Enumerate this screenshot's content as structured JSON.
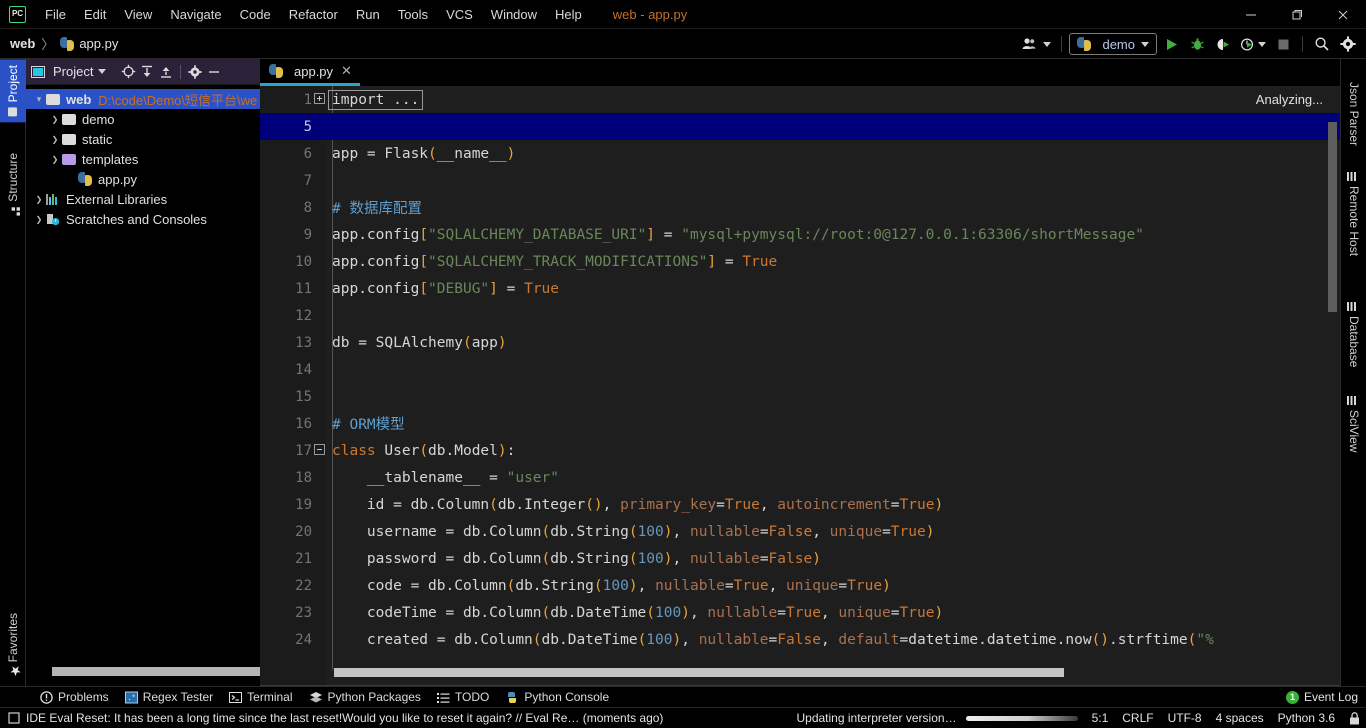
{
  "window": {
    "app_icon": "pycharm-logo-icon",
    "title": "web - app.py",
    "controls": {
      "minimize": "minimize-icon",
      "maximize": "maximize-icon",
      "close": "close-icon"
    }
  },
  "menu": {
    "items": [
      {
        "label": "File",
        "mnemonic": "F"
      },
      {
        "label": "Edit",
        "mnemonic": "E"
      },
      {
        "label": "View",
        "mnemonic": "V"
      },
      {
        "label": "Navigate",
        "mnemonic": "N"
      },
      {
        "label": "Code",
        "mnemonic": "C"
      },
      {
        "label": "Refactor",
        "mnemonic": "R"
      },
      {
        "label": "Run",
        "mnemonic": "u"
      },
      {
        "label": "Tools",
        "mnemonic": "T"
      },
      {
        "label": "VCS",
        "mnemonic": "V"
      },
      {
        "label": "Window",
        "mnemonic": "W"
      },
      {
        "label": "Help",
        "mnemonic": "H"
      }
    ]
  },
  "navbar": {
    "breadcrumbs": [
      {
        "label": "web",
        "icon": ""
      },
      {
        "label": "app.py",
        "icon": "python-file-icon"
      }
    ],
    "separator": "〉",
    "right": {
      "user_icon": "user-accounts-icon",
      "run_config": {
        "icon": "python-file-icon",
        "label": "demo",
        "caret": "chevron-down-icon"
      },
      "run_icon": "run-play-icon",
      "debug_icon": "debug-bug-icon",
      "coverage_icon": "run-with-coverage-icon",
      "profile_icon": "profile-icon",
      "stop_icon": "stop-icon",
      "search_icon": "search-icon",
      "settings_icon": "gear-icon"
    }
  },
  "left_strip": {
    "tabs": [
      {
        "label": "Project",
        "icon": "project-folder-icon",
        "selected": true
      },
      {
        "label": "Structure",
        "icon": "structure-icon",
        "selected": false
      }
    ],
    "bottom_tabs": [
      {
        "label": "Favorites",
        "icon": "star-icon",
        "selected": false
      }
    ]
  },
  "project_panel": {
    "title": "Project",
    "title_icon": "project-view-icon",
    "title_caret": "chevron-down-icon",
    "toolbar": [
      {
        "name": "select-opened-file-icon",
        "glyph": "⊕"
      },
      {
        "name": "expand-all-icon",
        "glyph": "↧"
      },
      {
        "name": "collapse-all-icon",
        "glyph": "↥"
      },
      {
        "name": "gear-icon",
        "glyph": "⚙"
      },
      {
        "name": "hide-icon",
        "glyph": "—"
      }
    ],
    "tree": [
      {
        "label": "web",
        "path": "D:\\code\\Demo\\短信平台\\we",
        "icon": "folder-icon",
        "indent": 0,
        "arrow": "expanded",
        "selected": true,
        "bold": true
      },
      {
        "label": "demo",
        "icon": "folder-icon",
        "indent": 1,
        "arrow": "collapsed",
        "selected": false,
        "bold": false
      },
      {
        "label": "static",
        "icon": "folder-icon",
        "indent": 1,
        "arrow": "collapsed",
        "selected": false,
        "bold": false
      },
      {
        "label": "templates",
        "icon": "folder-purple-icon",
        "indent": 1,
        "arrow": "collapsed",
        "selected": false,
        "bold": false
      },
      {
        "label": "app.py",
        "icon": "python-file-icon",
        "indent": 2,
        "arrow": "none",
        "selected": false,
        "bold": false
      },
      {
        "label": "External Libraries",
        "icon": "libraries-icon",
        "indent": 0,
        "arrow": "collapsed",
        "selected": false,
        "bold": false
      },
      {
        "label": "Scratches and Consoles",
        "icon": "scratches-icon",
        "indent": 0,
        "arrow": "collapsed",
        "selected": false,
        "bold": false
      }
    ]
  },
  "editor": {
    "tabs": [
      {
        "label": "app.py",
        "icon": "python-file-icon",
        "close": "✕",
        "active": true
      }
    ],
    "inspection_status": "Analyzing...",
    "caret_line": 5,
    "lines": [
      {
        "num": "1",
        "fold": "+",
        "boxed": true,
        "tokens": [
          {
            "t": "import ...",
            "c": "dim"
          }
        ]
      },
      {
        "num": "5",
        "fold": "",
        "highlight": true,
        "tokens": []
      },
      {
        "num": "6",
        "fold": "",
        "tokens": [
          {
            "t": "app ",
            "c": "dim"
          },
          {
            "t": "= ",
            "c": "dim"
          },
          {
            "t": "Flask",
            "c": "dim"
          },
          {
            "t": "(",
            "c": "par"
          },
          {
            "t": "__name__",
            "c": "dim"
          },
          {
            "t": ")",
            "c": "par"
          }
        ]
      },
      {
        "num": "7",
        "fold": "",
        "tokens": []
      },
      {
        "num": "8",
        "fold": "",
        "tokens": [
          {
            "t": "# ",
            "c": "cmt-ch"
          },
          {
            "t": "数据库配置",
            "c": "cmt-ch"
          }
        ]
      },
      {
        "num": "9",
        "fold": "",
        "tokens": [
          {
            "t": "app.config",
            "c": "dim"
          },
          {
            "t": "[",
            "c": "par"
          },
          {
            "t": "\"SQLALCHEMY_DATABASE_URI\"",
            "c": "str"
          },
          {
            "t": "]",
            "c": "par"
          },
          {
            "t": " = ",
            "c": "dim"
          },
          {
            "t": "\"mysql+pymysql://root:0@127.0.0.1:63306/shortMessage\"",
            "c": "str"
          }
        ]
      },
      {
        "num": "10",
        "fold": "",
        "tokens": [
          {
            "t": "app.config",
            "c": "dim"
          },
          {
            "t": "[",
            "c": "par"
          },
          {
            "t": "\"SQLALCHEMY_TRACK_MODIFICATIONS\"",
            "c": "str"
          },
          {
            "t": "]",
            "c": "par"
          },
          {
            "t": " = ",
            "c": "dim"
          },
          {
            "t": "True",
            "c": "kw"
          }
        ]
      },
      {
        "num": "11",
        "fold": "",
        "tokens": [
          {
            "t": "app.config",
            "c": "dim"
          },
          {
            "t": "[",
            "c": "par"
          },
          {
            "t": "\"DEBUG\"",
            "c": "str"
          },
          {
            "t": "]",
            "c": "par"
          },
          {
            "t": " = ",
            "c": "dim"
          },
          {
            "t": "True",
            "c": "kw"
          }
        ]
      },
      {
        "num": "12",
        "fold": "",
        "tokens": []
      },
      {
        "num": "13",
        "fold": "",
        "tokens": [
          {
            "t": "db = SQLAlchemy",
            "c": "dim"
          },
          {
            "t": "(",
            "c": "par"
          },
          {
            "t": "app",
            "c": "dim"
          },
          {
            "t": ")",
            "c": "par"
          }
        ]
      },
      {
        "num": "14",
        "fold": "",
        "tokens": []
      },
      {
        "num": "15",
        "fold": "",
        "tokens": []
      },
      {
        "num": "16",
        "fold": "",
        "tokens": [
          {
            "t": "# ORM模型",
            "c": "cmt-ch"
          }
        ]
      },
      {
        "num": "17",
        "fold": "-",
        "tokens": [
          {
            "t": "class ",
            "c": "kw"
          },
          {
            "t": "User",
            "c": "dim"
          },
          {
            "t": "(",
            "c": "par"
          },
          {
            "t": "db.Model",
            "c": "dim"
          },
          {
            "t": ")",
            "c": "par"
          },
          {
            "t": ":",
            "c": "dim"
          }
        ]
      },
      {
        "num": "18",
        "fold": "",
        "tokens": [
          {
            "t": "    __tablename__ = ",
            "c": "dim"
          },
          {
            "t": "\"user\"",
            "c": "str"
          }
        ]
      },
      {
        "num": "19",
        "fold": "",
        "tokens": [
          {
            "t": "    id = db.Column",
            "c": "dim"
          },
          {
            "t": "(",
            "c": "par"
          },
          {
            "t": "db.Integer",
            "c": "dim"
          },
          {
            "t": "()",
            "c": "par"
          },
          {
            "t": ", ",
            "c": "dim"
          },
          {
            "t": "primary_key",
            "c": "named"
          },
          {
            "t": "=",
            "c": "dim"
          },
          {
            "t": "True",
            "c": "kw"
          },
          {
            "t": ", ",
            "c": "dim"
          },
          {
            "t": "autoincrement",
            "c": "named"
          },
          {
            "t": "=",
            "c": "dim"
          },
          {
            "t": "True",
            "c": "kw"
          },
          {
            "t": ")",
            "c": "par"
          }
        ]
      },
      {
        "num": "20",
        "fold": "",
        "tokens": [
          {
            "t": "    username = db.Column",
            "c": "dim"
          },
          {
            "t": "(",
            "c": "par"
          },
          {
            "t": "db.String",
            "c": "dim"
          },
          {
            "t": "(",
            "c": "par"
          },
          {
            "t": "100",
            "c": "num"
          },
          {
            "t": ")",
            "c": "par"
          },
          {
            "t": ", ",
            "c": "dim"
          },
          {
            "t": "nullable",
            "c": "named"
          },
          {
            "t": "=",
            "c": "dim"
          },
          {
            "t": "False",
            "c": "kw"
          },
          {
            "t": ", ",
            "c": "dim"
          },
          {
            "t": "unique",
            "c": "named"
          },
          {
            "t": "=",
            "c": "dim"
          },
          {
            "t": "True",
            "c": "kw"
          },
          {
            "t": ")",
            "c": "par"
          }
        ]
      },
      {
        "num": "21",
        "fold": "",
        "tokens": [
          {
            "t": "    password = db.Column",
            "c": "dim"
          },
          {
            "t": "(",
            "c": "par"
          },
          {
            "t": "db.String",
            "c": "dim"
          },
          {
            "t": "(",
            "c": "par"
          },
          {
            "t": "100",
            "c": "num"
          },
          {
            "t": ")",
            "c": "par"
          },
          {
            "t": ", ",
            "c": "dim"
          },
          {
            "t": "nullable",
            "c": "named"
          },
          {
            "t": "=",
            "c": "dim"
          },
          {
            "t": "False",
            "c": "kw"
          },
          {
            "t": ")",
            "c": "par"
          }
        ]
      },
      {
        "num": "22",
        "fold": "",
        "tokens": [
          {
            "t": "    code = db.Column",
            "c": "dim"
          },
          {
            "t": "(",
            "c": "par"
          },
          {
            "t": "db.String",
            "c": "dim"
          },
          {
            "t": "(",
            "c": "par"
          },
          {
            "t": "100",
            "c": "num"
          },
          {
            "t": ")",
            "c": "par"
          },
          {
            "t": ", ",
            "c": "dim"
          },
          {
            "t": "nullable",
            "c": "named"
          },
          {
            "t": "=",
            "c": "dim"
          },
          {
            "t": "True",
            "c": "kw"
          },
          {
            "t": ", ",
            "c": "dim"
          },
          {
            "t": "unique",
            "c": "named"
          },
          {
            "t": "=",
            "c": "dim"
          },
          {
            "t": "True",
            "c": "kw"
          },
          {
            "t": ")",
            "c": "par"
          }
        ]
      },
      {
        "num": "23",
        "fold": "",
        "tokens": [
          {
            "t": "    codeTime = db.Column",
            "c": "dim"
          },
          {
            "t": "(",
            "c": "par"
          },
          {
            "t": "db.DateTime",
            "c": "dim"
          },
          {
            "t": "(",
            "c": "par"
          },
          {
            "t": "100",
            "c": "num"
          },
          {
            "t": ")",
            "c": "par"
          },
          {
            "t": ", ",
            "c": "dim"
          },
          {
            "t": "nullable",
            "c": "named"
          },
          {
            "t": "=",
            "c": "dim"
          },
          {
            "t": "True",
            "c": "kw"
          },
          {
            "t": ", ",
            "c": "dim"
          },
          {
            "t": "unique",
            "c": "named"
          },
          {
            "t": "=",
            "c": "dim"
          },
          {
            "t": "True",
            "c": "kw"
          },
          {
            "t": ")",
            "c": "par"
          }
        ]
      },
      {
        "num": "24",
        "fold": "",
        "tokens": [
          {
            "t": "    created = db.Column",
            "c": "dim"
          },
          {
            "t": "(",
            "c": "par"
          },
          {
            "t": "db.DateTime",
            "c": "dim"
          },
          {
            "t": "(",
            "c": "par"
          },
          {
            "t": "100",
            "c": "num"
          },
          {
            "t": ")",
            "c": "par"
          },
          {
            "t": ", ",
            "c": "dim"
          },
          {
            "t": "nullable",
            "c": "named"
          },
          {
            "t": "=",
            "c": "dim"
          },
          {
            "t": "False",
            "c": "kw"
          },
          {
            "t": ", ",
            "c": "dim"
          },
          {
            "t": "default",
            "c": "named"
          },
          {
            "t": "=",
            "c": "dim"
          },
          {
            "t": "datetime.datetime.now",
            "c": "dim"
          },
          {
            "t": "()",
            "c": "par"
          },
          {
            "t": ".strftime",
            "c": "dim"
          },
          {
            "t": "(",
            "c": "par"
          },
          {
            "t": "\"%",
            "c": "str"
          }
        ]
      }
    ]
  },
  "right_strip": {
    "tabs": [
      {
        "label": "Json Parser",
        "icon": "json-parser-icon"
      },
      {
        "label": "Remote Host",
        "icon": "remote-host-icon"
      },
      {
        "label": "Database",
        "icon": "database-icon"
      },
      {
        "label": "SciView",
        "icon": "sciview-icon"
      }
    ]
  },
  "bottom_bar": {
    "items": [
      {
        "label": "Problems",
        "icon": "problems-icon"
      },
      {
        "label": "Regex Tester",
        "icon": "regex-tester-icon"
      },
      {
        "label": "Terminal",
        "icon": "terminal-icon"
      },
      {
        "label": "Python Packages",
        "icon": "python-packages-icon"
      },
      {
        "label": "TODO",
        "icon": "todo-icon"
      },
      {
        "label": "Python Console",
        "icon": "python-console-icon"
      }
    ],
    "event_log": {
      "label": "Event Log",
      "count": "1"
    }
  },
  "status_bar": {
    "message": "IDE Eval Reset: It has been a long time since the last reset!Would you like to reset it again? // Eval Re… (moments ago)",
    "message_icon": "notification-icon",
    "progress_label": "Updating interpreter version…",
    "caret_position": "5:1",
    "line_separator": "CRLF",
    "encoding": "UTF-8",
    "indent": "4 spaces",
    "interpreter": "Python 3.6",
    "lock_icon": "lock-icon"
  },
  "colors": {
    "accent_blue": "#2b51c7",
    "tab_underline": "#2aa7c8",
    "caret_line": "#00007a",
    "editor_bg": "#1e1e1e",
    "panel_header": "#2b2139",
    "path_orange": "#c07030",
    "string_green": "#6a8759",
    "keyword_orange": "#cc7832",
    "number_blue": "#6897bb",
    "comment_blue": "#5f9ecf",
    "named_arg": "#a9714f",
    "paren_gold": "#e8a33d",
    "run_green": "#4caf50"
  }
}
